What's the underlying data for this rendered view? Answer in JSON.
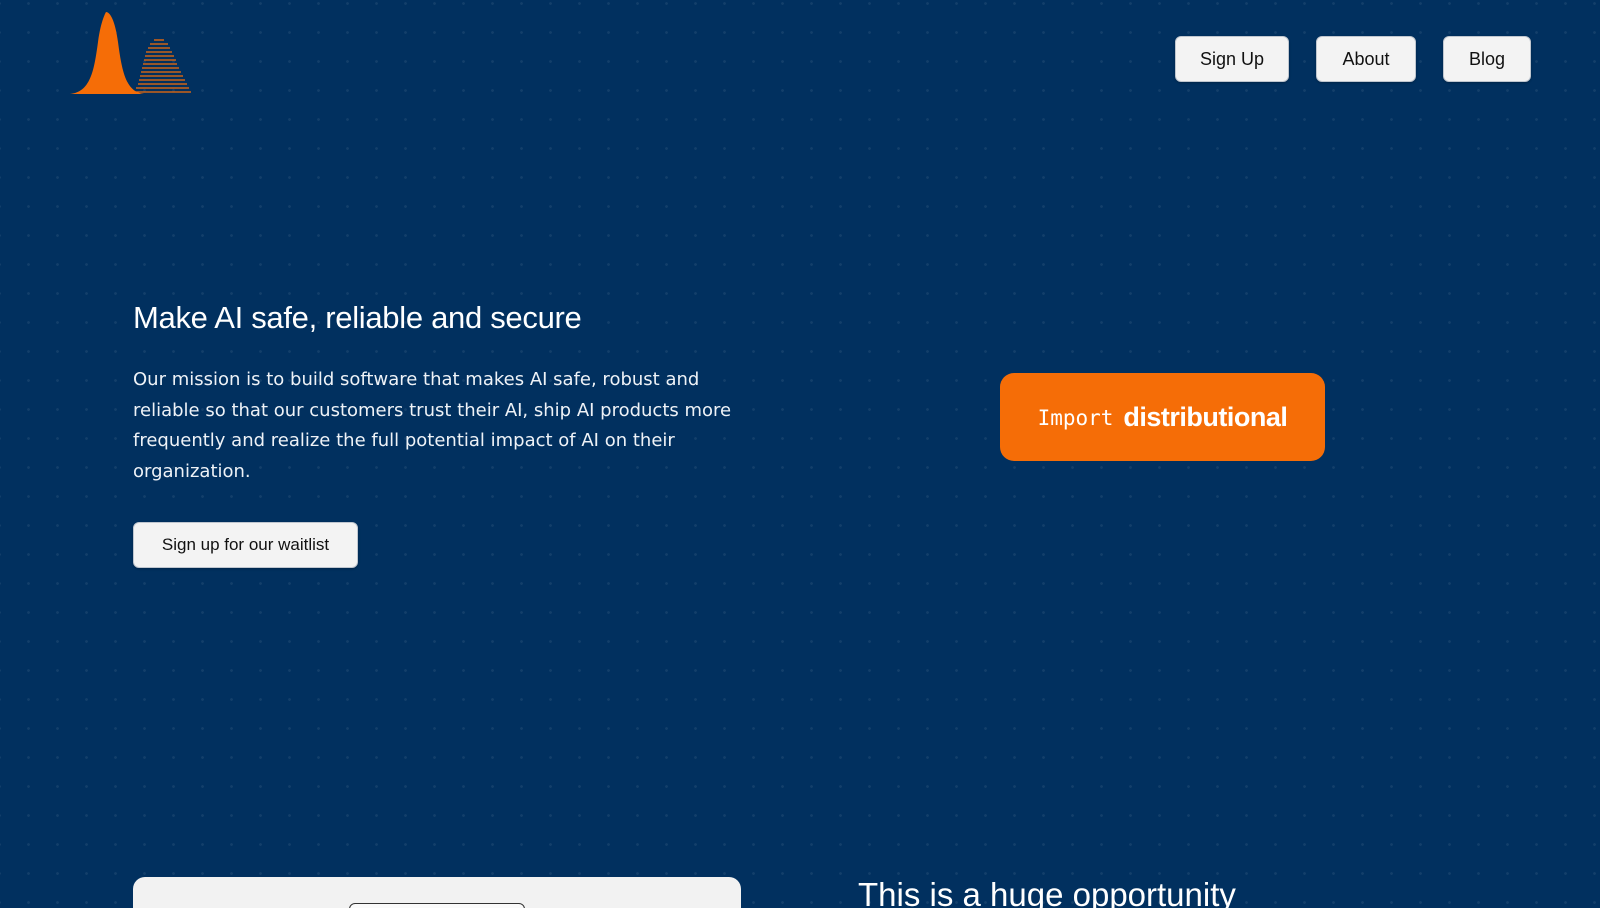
{
  "logo": {
    "icon": "bell-curve-logo-icon",
    "colors": {
      "primary": "#f56d07"
    }
  },
  "nav": {
    "signup_label": "Sign Up",
    "about_label": "About",
    "blog_label": "Blog"
  },
  "hero": {
    "title": "Make AI safe, reliable and secure",
    "text": "Our mission is to build software that makes AI safe, robust and reliable so that our customers trust their AI, ship AI products more frequently and realize the full potential impact of AI on their organization.",
    "waitlist_label": "Sign up for our waitlist"
  },
  "import_badge": {
    "keyword": "Import",
    "name": "distributional"
  },
  "next_section": {
    "title": "This is a huge opportunity"
  },
  "colors": {
    "background": "#01305f",
    "accent": "#f56d07",
    "button_bg": "#f3f3f3"
  }
}
